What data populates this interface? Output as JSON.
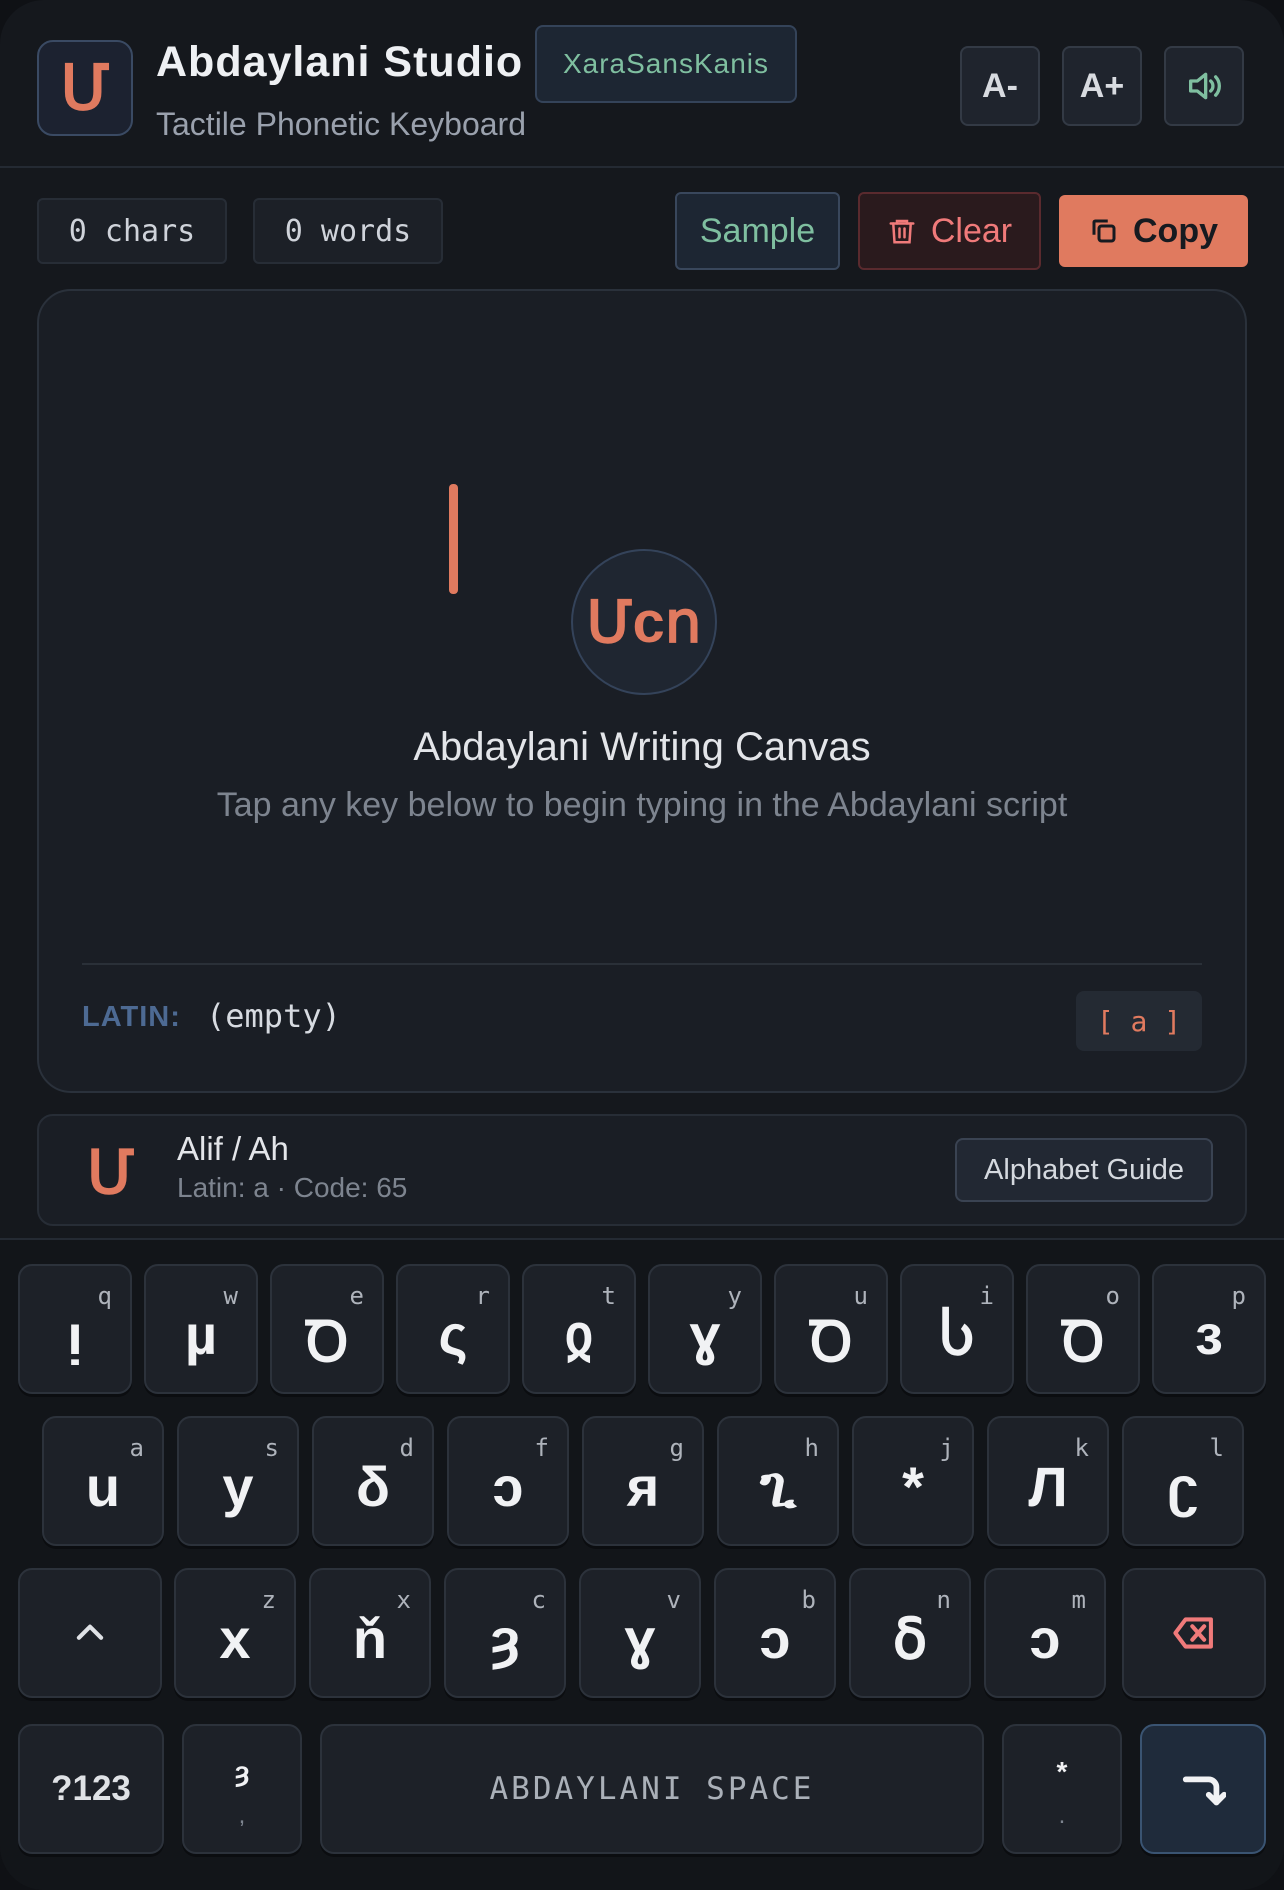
{
  "header": {
    "logo_glyph": "Մ",
    "title": "Abdaylani Studio",
    "subtitle": "Tactile Phonetic Keyboard",
    "font_badge": "XaraSansKanis",
    "font_decrease": "A-",
    "font_increase": "A+",
    "sound_icon": "speaker-icon"
  },
  "toolbar": {
    "chars": "0 chars",
    "words": "0 words",
    "sample": "Sample",
    "clear": "Clear",
    "copy": "Copy"
  },
  "canvas": {
    "emblem_glyph": "Մcո",
    "title": "Abdaylani Writing Canvas",
    "hint": "Tap any key below to begin typing in the Abdaylani script",
    "latin_label": "LATIN:",
    "latin_value": "(empty)",
    "current_key": "[ a ]"
  },
  "info": {
    "glyph": "Մ",
    "name": "Alif / Ah",
    "meta": "Latin: a · Code: 65",
    "guide_button": "Alphabet Guide"
  },
  "keyboard": {
    "row1": [
      {
        "latin": "q",
        "glyph": "ᴉ"
      },
      {
        "latin": "w",
        "glyph": "µ"
      },
      {
        "latin": "e",
        "glyph": "Ꝺ"
      },
      {
        "latin": "r",
        "glyph": "ς"
      },
      {
        "latin": "t",
        "glyph": "ჲ"
      },
      {
        "latin": "y",
        "glyph": "ɣ"
      },
      {
        "latin": "u",
        "glyph": "Ꝺ"
      },
      {
        "latin": "i",
        "glyph": "Ⴑ"
      },
      {
        "latin": "o",
        "glyph": "Ꝺ"
      },
      {
        "latin": "p",
        "glyph": "ɜ"
      }
    ],
    "row2": [
      {
        "latin": "a",
        "glyph": "u"
      },
      {
        "latin": "s",
        "glyph": "y"
      },
      {
        "latin": "d",
        "glyph": "δ"
      },
      {
        "latin": "f",
        "glyph": "ɔ"
      },
      {
        "latin": "g",
        "glyph": "ᴙ"
      },
      {
        "latin": "h",
        "glyph": "ጊ"
      },
      {
        "latin": "j",
        "glyph": "*"
      },
      {
        "latin": "k",
        "glyph": "Л"
      },
      {
        "latin": "l",
        "glyph": "ʗ"
      }
    ],
    "row3": [
      {
        "latin": "z",
        "glyph": "x"
      },
      {
        "latin": "x",
        "glyph": "ň"
      },
      {
        "latin": "c",
        "glyph": "ȝ"
      },
      {
        "latin": "v",
        "glyph": "ɣ"
      },
      {
        "latin": "b",
        "glyph": "ɔ"
      },
      {
        "latin": "n",
        "glyph": "ẟ"
      },
      {
        "latin": "m",
        "glyph": "ɔ"
      }
    ],
    "shift_icon": "shift-icon",
    "backspace_icon": "backspace-icon",
    "mode": "?123",
    "comma_glyph": "ȝ",
    "comma": ",",
    "space": "ABDAYLANI SPACE",
    "period_glyph": "*",
    "period": ".",
    "enter_icon": "enter-icon"
  },
  "colors": {
    "accent": "#e07a5f",
    "green": "#7fbfa0",
    "danger": "#f07a7a",
    "background": "#15181d"
  }
}
